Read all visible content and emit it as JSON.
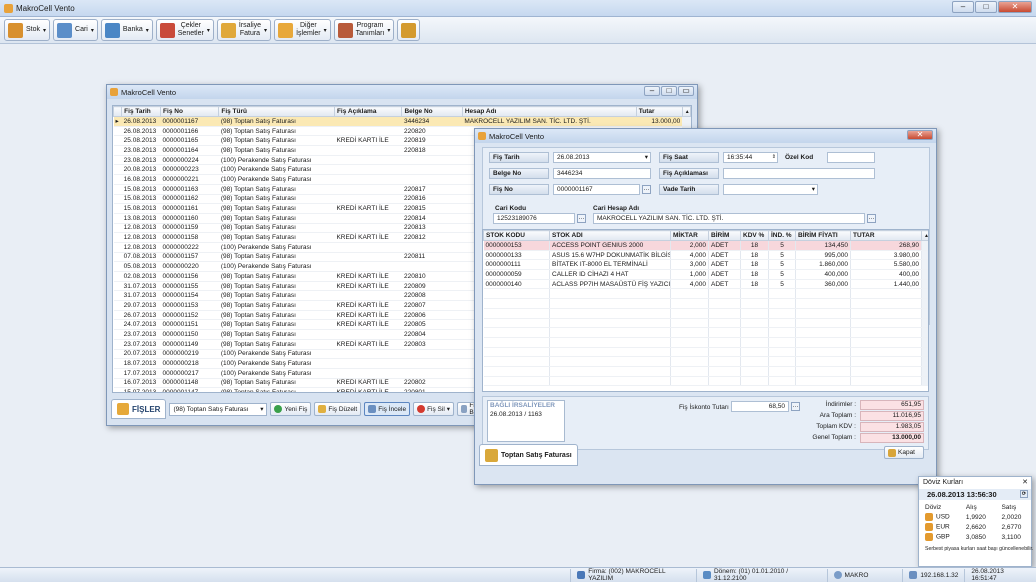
{
  "app_title": "MakroCell Vento",
  "toolbar": [
    {
      "label": "Stok",
      "icon": "box-icon",
      "color": "#d8902e"
    },
    {
      "label": "Cari",
      "icon": "people-icon",
      "color": "#5b8ec9"
    },
    {
      "label": "Banka",
      "icon": "bank-icon",
      "color": "#4a86c5"
    },
    {
      "label": "Çekler\nSenetler",
      "icon": "cheque-icon",
      "color": "#c94a3a"
    },
    {
      "label": "İrsaliye\nFatura",
      "icon": "invoice-icon",
      "color": "#e0a83a"
    },
    {
      "label": "Diğer\nİşlemler",
      "icon": "gear-icon",
      "color": "#e8a83a"
    },
    {
      "label": "Program\nTanımları",
      "icon": "settings-icon",
      "color": "#b85a3a"
    },
    {
      "label": "",
      "icon": "exit-icon",
      "color": "#d49a2e"
    }
  ],
  "fisler": {
    "title": "MakroCell Vento",
    "columns": [
      "Fiş Tarih",
      "Fiş No",
      "Fiş Türü",
      "Fiş Açıklama",
      "Belge No",
      "Hesap Adı",
      "Tutar"
    ],
    "rows": [
      [
        "26.08.2013",
        "0000001167",
        "(98) Toptan Satış Faturası",
        "",
        "3446234",
        "MAKROCELL YAZILIM SAN. TİC. LTD. ŞTİ.",
        "13.000,00"
      ],
      [
        "26.08.2013",
        "0000001166",
        "(98) Toptan Satış Faturası",
        "",
        "220820",
        "",
        ""
      ],
      [
        "25.08.2013",
        "0000001165",
        "(98) Toptan Satış Faturası",
        "KREDİ KARTI İLE",
        "220819",
        "",
        ""
      ],
      [
        "23.08.2013",
        "0000001164",
        "(98) Toptan Satış Faturası",
        "",
        "220818",
        "",
        ""
      ],
      [
        "23.08.2013",
        "0000000224",
        "(100) Perakende Satış Faturası",
        "",
        "",
        "",
        ""
      ],
      [
        "20.08.2013",
        "0000000223",
        "(100) Perakende Satış Faturası",
        "",
        "",
        "",
        ""
      ],
      [
        "16.08.2013",
        "0000000221",
        "(100) Perakende Satış Faturası",
        "",
        "",
        "",
        ""
      ],
      [
        "15.08.2013",
        "0000001163",
        "(98) Toptan Satış Faturası",
        "",
        "220817",
        "",
        ""
      ],
      [
        "15.08.2013",
        "0000001162",
        "(98) Toptan Satış Faturası",
        "",
        "220816",
        "",
        ""
      ],
      [
        "15.08.2013",
        "0000001161",
        "(98) Toptan Satış Faturası",
        "KREDİ KARTI İLE",
        "220815",
        "",
        ""
      ],
      [
        "13.08.2013",
        "0000001160",
        "(98) Toptan Satış Faturası",
        "",
        "220814",
        "",
        ""
      ],
      [
        "12.08.2013",
        "0000001159",
        "(98) Toptan Satış Faturası",
        "",
        "220813",
        "",
        ""
      ],
      [
        "12.08.2013",
        "0000001158",
        "(98) Toptan Satış Faturası",
        "KREDİ KARTI İLE",
        "220812",
        "",
        ""
      ],
      [
        "12.08.2013",
        "0000000222",
        "(100) Perakende Satış Faturası",
        "",
        "",
        "",
        ""
      ],
      [
        "07.08.2013",
        "0000001157",
        "(98) Toptan Satış Faturası",
        "",
        "220811",
        "",
        ""
      ],
      [
        "05.08.2013",
        "0000000220",
        "(100) Perakende Satış Faturası",
        "",
        "",
        "",
        ""
      ],
      [
        "02.08.2013",
        "0000001156",
        "(98) Toptan Satış Faturası",
        "KREDİ KARTI İLE",
        "220810",
        "",
        ""
      ],
      [
        "31.07.2013",
        "0000001155",
        "(98) Toptan Satış Faturası",
        "KREDİ KARTI İLE",
        "220809",
        "",
        ""
      ],
      [
        "31.07.2013",
        "0000001154",
        "(98) Toptan Satış Faturası",
        "",
        "220808",
        "",
        ""
      ],
      [
        "29.07.2013",
        "0000001153",
        "(98) Toptan Satış Faturası",
        "KREDİ KARTI İLE",
        "220807",
        "",
        ""
      ],
      [
        "26.07.2013",
        "0000001152",
        "(98) Toptan Satış Faturası",
        "KREDİ KARTI İLE",
        "220806",
        "",
        ""
      ],
      [
        "24.07.2013",
        "0000001151",
        "(98) Toptan Satış Faturası",
        "KREDİ KARTI İLE",
        "220805",
        "",
        ""
      ],
      [
        "23.07.2013",
        "0000001150",
        "(98) Toptan Satış Faturası",
        "",
        "220804",
        "",
        ""
      ],
      [
        "23.07.2013",
        "0000001149",
        "(98) Toptan Satış Faturası",
        "KREDİ KARTI İLE",
        "220803",
        "",
        ""
      ],
      [
        "20.07.2013",
        "0000000219",
        "(100) Perakende Satış Faturası",
        "",
        "",
        "",
        ""
      ],
      [
        "18.07.2013",
        "0000000218",
        "(100) Perakende Satış Faturası",
        "",
        "",
        "",
        ""
      ],
      [
        "17.07.2013",
        "0000000217",
        "(100) Perakende Satış Faturası",
        "",
        "",
        "",
        ""
      ],
      [
        "16.07.2013",
        "0000001148",
        "(98) Toptan Satış Faturası",
        "KREDİ KARTI İLE",
        "220802",
        "",
        ""
      ],
      [
        "15.07.2013",
        "0000001147",
        "(98) Toptan Satış Faturası",
        "KREDİ KARTI İLE",
        "220801",
        "",
        ""
      ]
    ],
    "tab_label": "FİŞLER",
    "filter_value": "(98) Toptan Satış Faturası",
    "buttons": [
      "Yeni Fiş",
      "Fiş Düzelt",
      "Fiş İncele",
      "Fiş Sil",
      "Fiş B"
    ]
  },
  "fatura": {
    "title": "MakroCell Vento",
    "fis_tarih_label": "Fiş Tarih",
    "fis_tarih": "26.08.2013",
    "belge_no_label": "Belge No",
    "belge_no": "3446234",
    "fis_no_label": "Fiş No",
    "fis_no": "0000001167",
    "fis_saat_label": "Fiş Saat",
    "fis_saat": "16:35:44",
    "ozel_kod_label": "Özel Kod",
    "fis_aciklama_label": "Fiş Açıklaması",
    "vade_tarih_label": "Vade Tarih",
    "cari_kodu_label": "Cari Kodu",
    "cari_kodu": "12523189076",
    "cari_hesap_label": "Cari Hesap Adı",
    "cari_hesap": "MAKROCELL YAZILIM SAN. TİC. LTD. ŞTİ.",
    "columns": [
      "STOK KODU",
      "STOK ADI",
      "MİKTAR",
      "BİRİM",
      "KDV %",
      "İND. %",
      "BİRİM FİYATI",
      "TUTAR"
    ],
    "rows": [
      [
        "0000000153",
        "ACCESS POINT GENIUS 2000",
        "2,000",
        "ADET",
        "18",
        "5",
        "134,450",
        "268,90"
      ],
      [
        "0000000133",
        "ASUS 15.6 W7HP DOKUNMATİK BİLGİSAYAR",
        "4,000",
        "ADET",
        "18",
        "5",
        "995,000",
        "3.980,00"
      ],
      [
        "0000000111",
        "BİTATEK IT-8000 EL TERMİNALİ",
        "3,000",
        "ADET",
        "18",
        "5",
        "1.860,000",
        "5.580,00"
      ],
      [
        "0000000059",
        "CALLER ID CİHAZI 4 HAT",
        "1,000",
        "ADET",
        "18",
        "5",
        "400,000",
        "400,00"
      ],
      [
        "0000000140",
        "ACLASS PP7IH MASAÜSTÜ FİŞ YAZICI USB",
        "4,000",
        "ADET",
        "18",
        "5",
        "360,000",
        "1.440,00"
      ]
    ],
    "bagli_label": "BAĞLI İRSALİYELER",
    "bagli_value": "26.08.2013 / 1163",
    "iskonto_label": "Fiş İskonto Tutarı :",
    "iskonto_value": "68,50",
    "totals": [
      {
        "label": "İndirimler :",
        "value": "651,95"
      },
      {
        "label": "Ara Toplam :",
        "value": "11.016,95"
      },
      {
        "label": "Toplam KDV :",
        "value": "1.983,05"
      },
      {
        "label": "Genel Toplam :",
        "value": "13.000,00"
      }
    ],
    "tab_label": "Toptan Satış Faturası",
    "close_label": "Kapat"
  },
  "doviz": {
    "title": "Döviz Kurları",
    "datetime": "26.08.2013 13:56:30",
    "headers": [
      "Döviz",
      "Alış",
      "Satış"
    ],
    "rows": [
      [
        "USD",
        "1,9920",
        "2,0020"
      ],
      [
        "EUR",
        "2,6620",
        "2,6770"
      ],
      [
        "GBP",
        "3,0850",
        "3,1100"
      ]
    ],
    "note": "Serbest piyasa kurları saat başı güncellenebilir."
  },
  "status": {
    "firma": "Firma: (002) MAKROCELL YAZILIM",
    "donem": "Dönem: (01) 01.01.2010 / 31.12.2100",
    "user": "MAKRO",
    "ip": "192.168.1.32",
    "datetime": "26.08.2013 16:51:47"
  }
}
